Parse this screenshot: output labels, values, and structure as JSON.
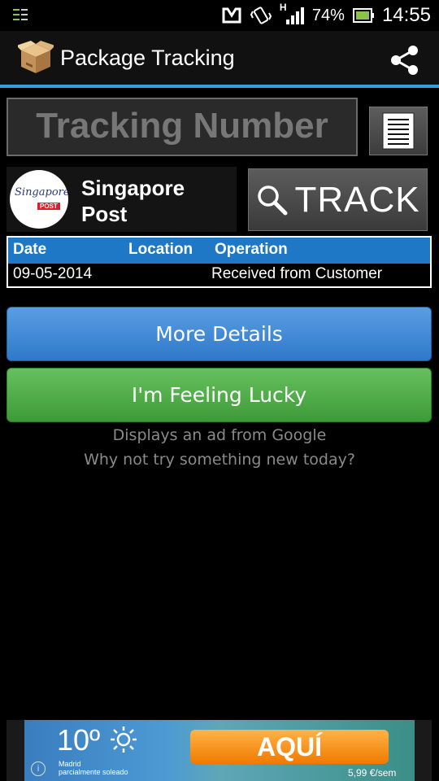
{
  "status_bar": {
    "battery": "74%",
    "time": "14:55",
    "network_type": "H"
  },
  "action_bar": {
    "title": "Package Tracking"
  },
  "tracking": {
    "placeholder": "Tracking Number"
  },
  "carrier": {
    "name": "Singapore Post",
    "logo_text": "Singapore",
    "logo_subtext": "POST"
  },
  "track_button": {
    "label": "TRACK"
  },
  "table": {
    "headers": [
      "Date",
      "Location",
      "Operation"
    ],
    "rows": [
      {
        "date": "09-05-2014",
        "location": "",
        "operation": "Received from Customer"
      }
    ]
  },
  "buttons": {
    "more_details": "More Details",
    "feeling_lucky": "I'm Feeling Lucky"
  },
  "hints": {
    "line1": "Displays an ad from Google",
    "line2": "Why not try something new today?"
  },
  "ad": {
    "temperature": "10º",
    "city": "Madrid",
    "condition": "parcialmente soleado",
    "cta": "AQUÍ",
    "price": "5,99 €/sem",
    "info": "i"
  },
  "colors": {
    "accent": "#33a1de",
    "table_header": "#1e78c6",
    "more_button": "#2f79c9",
    "lucky_button": "#3e9a38"
  },
  "icons": [
    "download-notification-icon",
    "vibrate-icon",
    "signal-icon",
    "battery-icon",
    "package-box-icon",
    "share-icon",
    "clipboard-icon",
    "search-icon",
    "sun-icon",
    "info-icon"
  ]
}
